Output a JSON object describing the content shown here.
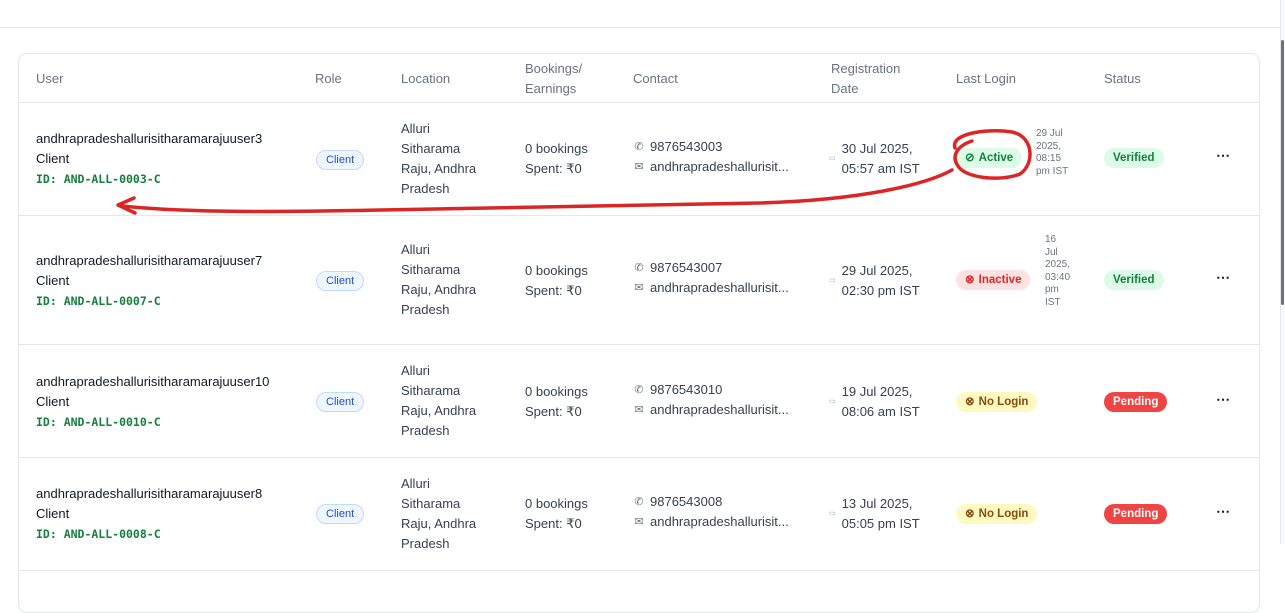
{
  "table": {
    "columns": {
      "user": "User",
      "role": "Role",
      "location": "Location",
      "bookings_1": "Bookings/",
      "bookings_2": "Earnings",
      "contact": "Contact",
      "registration_1": "Registration",
      "registration_2": "Date",
      "last_login": "Last Login",
      "status": "Status"
    },
    "rows": [
      {
        "name": "andhrapradeshallurisitharamarajuuser3",
        "type": "Client",
        "id": "ID: AND-ALL-0003-C",
        "role": "Client",
        "location": [
          "Alluri",
          "Sitharama",
          "Raju, Andhra",
          "Pradesh"
        ],
        "bookings": "0 bookings",
        "spent": "Spent: ₹0",
        "phone": "9876543003",
        "email": "andhrapradeshallurisit...",
        "reg_date": "30 Jul 2025,",
        "reg_time": "05:57 am IST",
        "login_status": "Active",
        "login_icon": "check-circle-icon",
        "last_time": [
          "29 Jul",
          "2025,",
          "08:15",
          "pm IST"
        ],
        "status": "Verified",
        "more": "⋯"
      },
      {
        "name": "andhrapradeshallurisitharamarajuuser7",
        "type": "Client",
        "id": "ID: AND-ALL-0007-C",
        "role": "Client",
        "location": [
          "Alluri",
          "Sitharama",
          "Raju, Andhra",
          "Pradesh"
        ],
        "bookings": "0 bookings",
        "spent": "Spent: ₹0",
        "phone": "9876543007",
        "email": "andhrapradeshallurisit...",
        "reg_date": "29 Jul 2025,",
        "reg_time": "02:30 pm IST",
        "login_status": "Inactive",
        "login_icon": "x-circle-icon",
        "last_time": [
          "16",
          "Jul",
          "2025,",
          "03:40",
          "pm",
          "IST"
        ],
        "status": "Verified",
        "more": "⋯"
      },
      {
        "name": "andhrapradeshallurisitharamarajuuser10",
        "type": "Client",
        "id": "ID: AND-ALL-0010-C",
        "role": "Client",
        "location": [
          "Alluri",
          "Sitharama",
          "Raju, Andhra",
          "Pradesh"
        ],
        "bookings": "0 bookings",
        "spent": "Spent: ₹0",
        "phone": "9876543010",
        "email": "andhrapradeshallurisit...",
        "reg_date": "19 Jul 2025,",
        "reg_time": "08:06 am IST",
        "login_status": "No Login",
        "login_icon": "x-circle-icon",
        "last_time": [],
        "status": "Pending",
        "more": "⋯"
      },
      {
        "name": "andhrapradeshallurisitharamarajuuser8",
        "type": "Client",
        "id": "ID: AND-ALL-0008-C",
        "role": "Client",
        "location": [
          "Alluri",
          "Sitharama",
          "Raju, Andhra",
          "Pradesh"
        ],
        "bookings": "0 bookings",
        "spent": "Spent: ₹0",
        "phone": "9876543008",
        "email": "andhrapradeshallurisit...",
        "reg_date": "13 Jul 2025,",
        "reg_time": "05:05 pm IST",
        "login_status": "No Login",
        "login_icon": "x-circle-icon",
        "last_time": [],
        "status": "Pending",
        "more": "⋯"
      }
    ]
  },
  "icons": {
    "phone": "phone-icon",
    "mail": "mail-icon",
    "calendar": "calendar-icon"
  },
  "colors": {
    "active": "#15803d",
    "inactive": "#dc2626",
    "no_login": "#854d0e",
    "verified": "#15803d",
    "pending": "#ef4444",
    "annotation": "#dc2626"
  }
}
